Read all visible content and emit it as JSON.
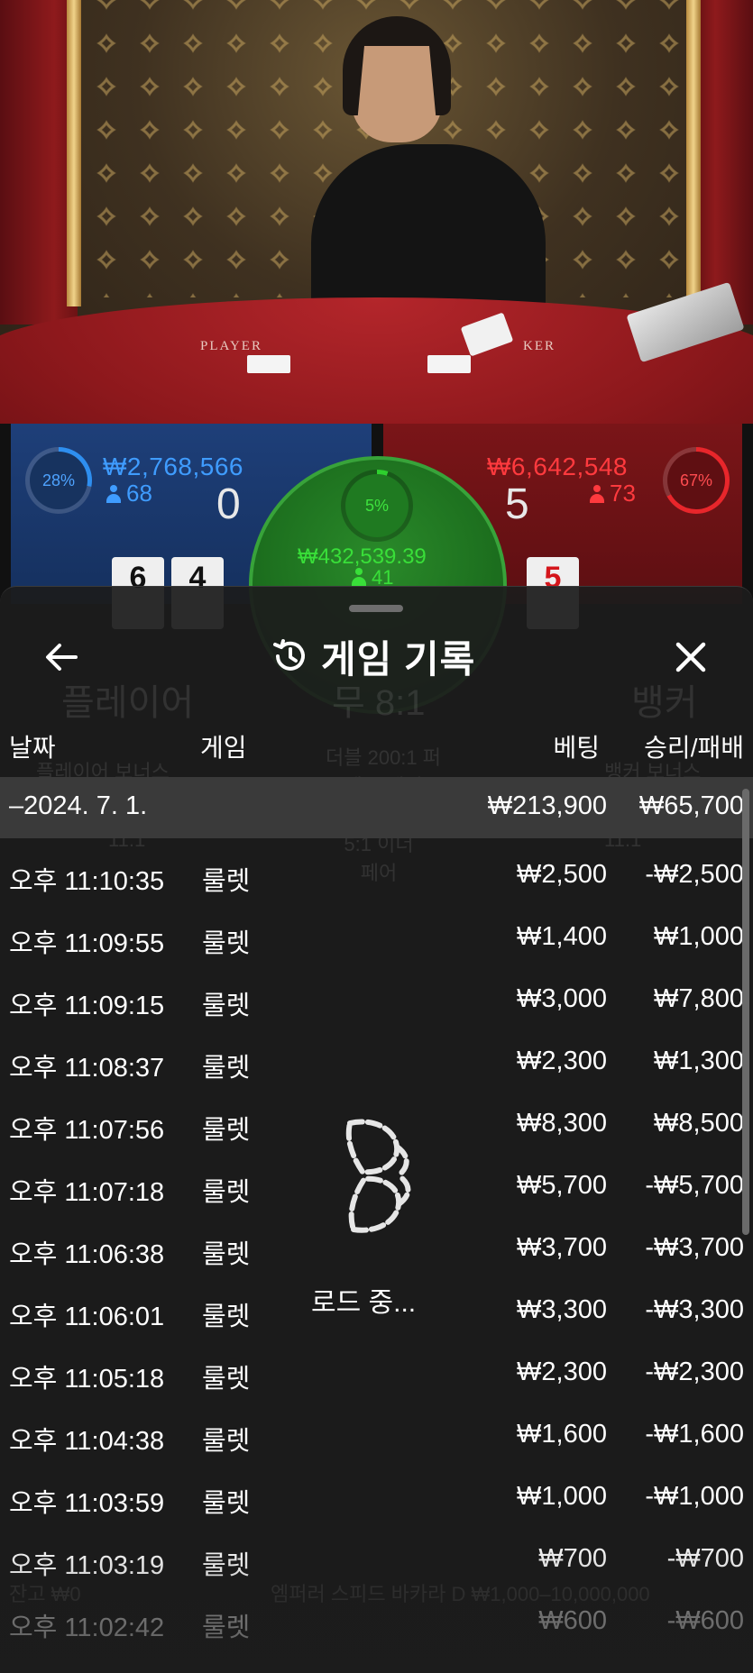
{
  "video": {
    "felt_player": "PLAYER",
    "felt_banker": "KER"
  },
  "scoreboard": {
    "player": {
      "percent": "28%",
      "amount": "₩2,768,566",
      "count": "68",
      "score": "0",
      "cards": [
        "6",
        "4"
      ]
    },
    "tie": {
      "percent": "5%",
      "amount": "₩432,539.39",
      "count": "41"
    },
    "banker": {
      "percent": "67%",
      "amount": "₩6,642,548",
      "count": "73",
      "score": "5",
      "cards": [
        "5"
      ]
    },
    "colors": {
      "player": "#3f9cff",
      "tie": "#39df39",
      "banker": "#ff3a3e"
    }
  },
  "sheet": {
    "title": "게임 기록",
    "back_icon": "arrow-left-icon",
    "history_icon": "history-icon",
    "close_icon": "close-icon",
    "columns": {
      "date": "날짜",
      "game": "게임",
      "bet": "베팅",
      "result": "승리/패배"
    },
    "date_group": {
      "label": "–2024. 7. 1.",
      "bet": "₩213,900",
      "result": "₩65,700"
    },
    "rows": [
      {
        "time": "오후 11:10:35",
        "game": "룰렛",
        "bet": "₩2,500",
        "result": "-₩2,500"
      },
      {
        "time": "오후 11:09:55",
        "game": "룰렛",
        "bet": "₩1,400",
        "result": "₩1,000"
      },
      {
        "time": "오후 11:09:15",
        "game": "룰렛",
        "bet": "₩3,000",
        "result": "₩7,800"
      },
      {
        "time": "오후 11:08:37",
        "game": "룰렛",
        "bet": "₩2,300",
        "result": "₩1,300"
      },
      {
        "time": "오후 11:07:56",
        "game": "룰렛",
        "bet": "₩8,300",
        "result": "₩8,500"
      },
      {
        "time": "오후 11:07:18",
        "game": "룰렛",
        "bet": "₩5,700",
        "result": "-₩5,700"
      },
      {
        "time": "오후 11:06:38",
        "game": "룰렛",
        "bet": "₩3,700",
        "result": "-₩3,700"
      },
      {
        "time": "오후 11:06:01",
        "game": "룰렛",
        "bet": "₩3,300",
        "result": "-₩3,300"
      },
      {
        "time": "오후 11:05:18",
        "game": "룰렛",
        "bet": "₩2,300",
        "result": "-₩2,300"
      },
      {
        "time": "오후 11:04:38",
        "game": "룰렛",
        "bet": "₩1,600",
        "result": "-₩1,600"
      },
      {
        "time": "오후 11:03:59",
        "game": "룰렛",
        "bet": "₩1,000",
        "result": "-₩1,000"
      },
      {
        "time": "오후 11:03:19",
        "game": "룰렛",
        "bet": "₩700",
        "result": "-₩700"
      },
      {
        "time": "오후 11:02:42",
        "game": "룰렛",
        "bet": "₩600",
        "result": "-₩600"
      }
    ],
    "loading_text": "로드 중..."
  },
  "background": {
    "player_label": "플레이어",
    "tie_label": "무 8:1",
    "banker_label": "뱅커",
    "player_bonus": "플레이어 보너스",
    "perfect_pair": "더블 200:1 퍼펙트 페어",
    "banker_bonus": "뱅커 보너스",
    "either_pair": "5:1 이더 페어",
    "ratio_left": "11:1",
    "ratio_right": "11:1",
    "balance": "잔고 ₩0",
    "table_info": "엠퍼러 스피드 바카라 D ₩1,000–10,000,000"
  }
}
